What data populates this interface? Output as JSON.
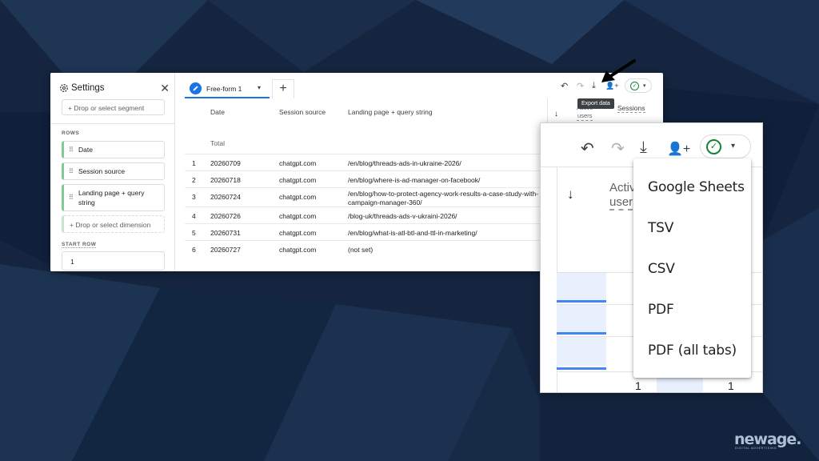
{
  "settings": {
    "title": "Settings",
    "close_glyph": "✕",
    "segment_placeholder": "+ Drop or select segment",
    "rows_label": "ROWS",
    "rows": [
      "Date",
      "Session source",
      "Landing page + query string"
    ],
    "dimension_placeholder": "+ Drop or select dimension",
    "start_row_label": "START ROW",
    "start_row_value": "1"
  },
  "tabs": {
    "active_label": "Free-form 1",
    "add_glyph": "+"
  },
  "toolbar": {
    "undo_glyph": "↶",
    "redo_glyph": "↷",
    "export_glyph": "⤓",
    "share_glyph": "👤+",
    "check_glyph": "✓",
    "caret_glyph": "▾",
    "tooltip": "Export data"
  },
  "table": {
    "headers": {
      "date": "Date",
      "source": "Session source",
      "landing": "Landing page + query string",
      "sort_glyph": "↓",
      "active_users_1": "Active",
      "active_users_2": "users",
      "sessions": "Sessions"
    },
    "total_label": "Total",
    "rows": [
      {
        "n": "1",
        "date": "20260709",
        "source": "chatgpt.com",
        "landing": "/en/blog/threads-ads-in-ukraine-2026/"
      },
      {
        "n": "2",
        "date": "20260718",
        "source": "chatgpt.com",
        "landing": "/en/blog/where-is-ad-manager-on-facebook/"
      },
      {
        "n": "3",
        "date": "20260724",
        "source": "chatgpt.com",
        "landing": "/en/blog/how-to-protect-agency-work-results-a-case-study-with-campaign-manager-360/"
      },
      {
        "n": "4",
        "date": "20260726",
        "source": "chatgpt.com",
        "landing": "/blog-uk/threads-ads-v-ukraini-2026/"
      },
      {
        "n": "5",
        "date": "20260731",
        "source": "chatgpt.com",
        "landing": "/en/blog/what-is-atl-btl-and-ttl-in-marketing/"
      },
      {
        "n": "6",
        "date": "20260727",
        "source": "chatgpt.com",
        "landing": "(not set)"
      }
    ]
  },
  "zoom": {
    "sort_glyph": "↓",
    "active_partial_1": "Activ",
    "active_partial_2": "user",
    "values": [
      "1",
      "1"
    ]
  },
  "export_menu": {
    "items": [
      "Google Sheets",
      "TSV",
      "CSV",
      "PDF",
      "PDF (all tabs)"
    ]
  },
  "brand": {
    "logo_text": "newage.",
    "logo_sub": "DIGITAL ADVERTISING"
  },
  "colors": {
    "background": "#15253f",
    "accent_blue": "#1a73e8",
    "check_green": "#188038",
    "row_green": "#81c995"
  }
}
